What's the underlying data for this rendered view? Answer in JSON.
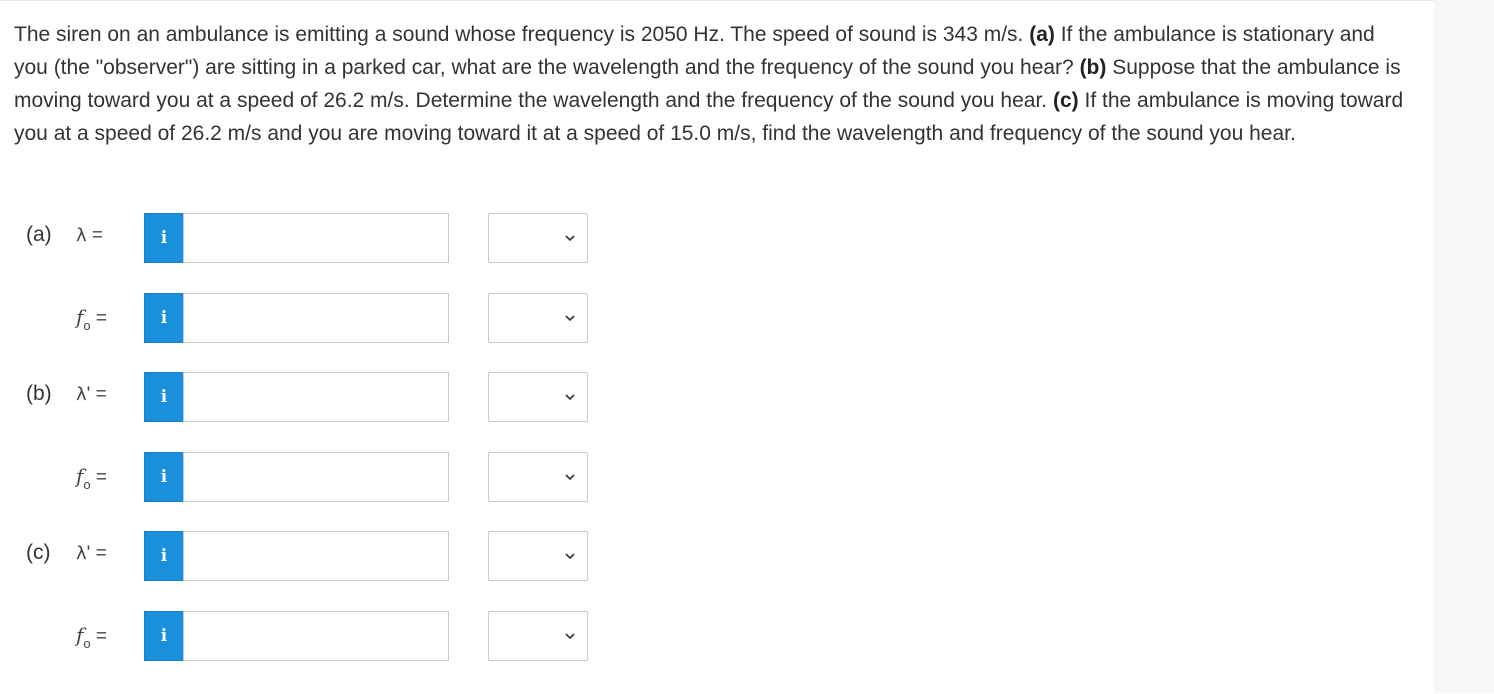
{
  "question": {
    "intro": "The siren on an ambulance is emitting a sound whose frequency is 2050 Hz. The speed of sound is 343 m/s. ",
    "a_tag": "(a)",
    "a_text": " If the ambulance is stationary and you (the \"observer\") are sitting in a parked car, what are the wavelength and the frequency of the sound you hear? ",
    "b_tag": "(b)",
    "b_text": " Suppose that the ambulance is moving toward you at a speed of 26.2 m/s. Determine the wavelength and the frequency of the sound you hear. ",
    "c_tag": "(c)",
    "c_text": " If the ambulance is moving toward you at a speed of 26.2 m/s and you are moving toward it at a speed of 15.0 m/s, find the wavelength and frequency of the sound you hear."
  },
  "rows": [
    {
      "part": "(a)",
      "symbol": "λ",
      "prime": "",
      "sub": "",
      "eq": " =",
      "info": "i",
      "value": "",
      "unit": ""
    },
    {
      "part": "",
      "symbol": "f",
      "prime": "",
      "sub": "o",
      "eq": " =",
      "info": "i",
      "value": "",
      "unit": ""
    },
    {
      "part": "(b)",
      "symbol": "λ",
      "prime": "'",
      "sub": "",
      "eq": " =",
      "info": "i",
      "value": "",
      "unit": ""
    },
    {
      "part": "",
      "symbol": "f",
      "prime": "",
      "sub": "o",
      "eq": " =",
      "info": "i",
      "value": "",
      "unit": ""
    },
    {
      "part": "(c)",
      "symbol": "λ",
      "prime": "'",
      "sub": "",
      "eq": " =",
      "info": "i",
      "value": "",
      "unit": ""
    },
    {
      "part": "",
      "symbol": "f",
      "prime": "",
      "sub": "o",
      "eq": " =",
      "info": "i",
      "value": "",
      "unit": ""
    }
  ],
  "icons": {
    "info": "info-icon",
    "dropdown": "chevron-down-icon"
  },
  "colors": {
    "info_button": "#1a8fdb",
    "text": "#333333",
    "border": "#c9c9c9"
  }
}
